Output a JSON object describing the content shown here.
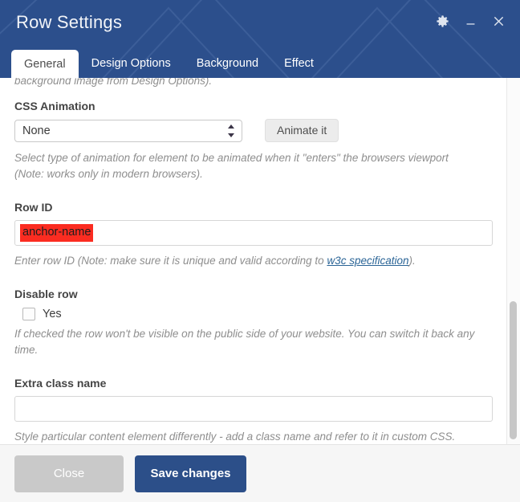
{
  "window": {
    "title": "Row Settings",
    "controls": [
      {
        "name": "settings-gear",
        "icon": "gear-icon"
      },
      {
        "name": "minimize",
        "icon": "minimize-icon"
      },
      {
        "name": "close",
        "icon": "close-icon"
      }
    ]
  },
  "tabs": [
    {
      "label": "General",
      "active": true
    },
    {
      "label": "Design Options",
      "active": false
    },
    {
      "label": "Background",
      "active": false
    },
    {
      "label": "Effect",
      "active": false
    }
  ],
  "form": {
    "cut_off_hint": "background image from Design Options).",
    "css_animation": {
      "label": "CSS Animation",
      "value": "None",
      "options": [
        "None"
      ],
      "button_label": "Animate it",
      "hint": "Select type of animation for element to be animated when it \"enters\" the browsers viewport (Note: works only in modern browsers)."
    },
    "row_id": {
      "label": "Row ID",
      "value": "anchor-name",
      "highlight_color": "#fb2c21",
      "hint_before": "Enter row ID (Note: make sure it is unique and valid according to ",
      "hint_link": "w3c specification",
      "hint_after": ")."
    },
    "disable_row": {
      "label": "Disable row",
      "checkbox_label": "Yes",
      "checked": false,
      "hint": "If checked the row won't be visible on the public side of your website. You can switch it back any time."
    },
    "extra_class": {
      "label": "Extra class name",
      "value": "",
      "placeholder": "",
      "hint": "Style particular content element differently - add a class name and refer to it in custom CSS."
    }
  },
  "footer": {
    "close_label": "Close",
    "save_label": "Save changes"
  },
  "theme": {
    "header_blue": "#2c4f8c",
    "primary_blue": "#2c4f89",
    "link_blue": "#2a6496",
    "close_gray": "#c9c9c9"
  }
}
